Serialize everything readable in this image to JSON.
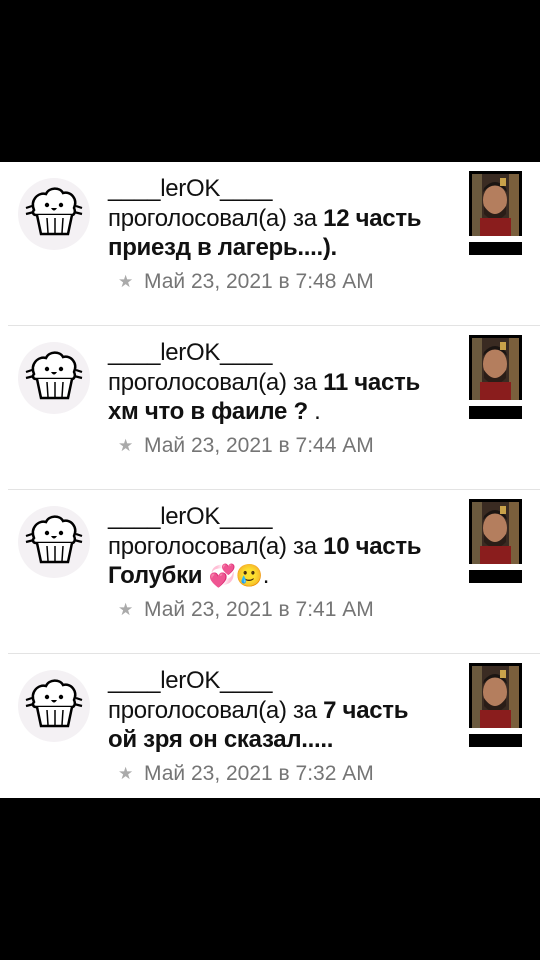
{
  "items": [
    {
      "username": "____lerOK____",
      "verb": "проголосовал(а) за",
      "part": "12 часть",
      "title": "приезд в лагерь....).",
      "emoji": "",
      "timestamp": "Май 23, 2021 в 7:48 AM"
    },
    {
      "username": "____lerOK____",
      "verb": "проголосовал(а) за",
      "part": "11 часть",
      "title": "хм что в фаиле ?",
      "tail": " .",
      "emoji": "",
      "timestamp": "Май 23, 2021 в 7:44 AM"
    },
    {
      "username": "____lerOK____",
      "verb": "проголосовал(а) за",
      "part": "10 часть",
      "title": "Голубки ",
      "emoji": "💞🥲",
      "tail": ".",
      "timestamp": "Май 23, 2021 в 7:41 AM"
    },
    {
      "username": "____lerOK____",
      "verb": "проголосовал(а) за",
      "part": "7 часть",
      "title": "ой зря он сказал.....",
      "emoji": "",
      "timestamp": "Май 23, 2021 в 7:32 AM"
    }
  ],
  "icons": {
    "avatar": "muffin-avatar-icon",
    "star": "star-icon"
  },
  "colors": {
    "background": "#ffffff",
    "text": "#111111",
    "meta": "#757575",
    "divider": "#e3e3e3"
  }
}
